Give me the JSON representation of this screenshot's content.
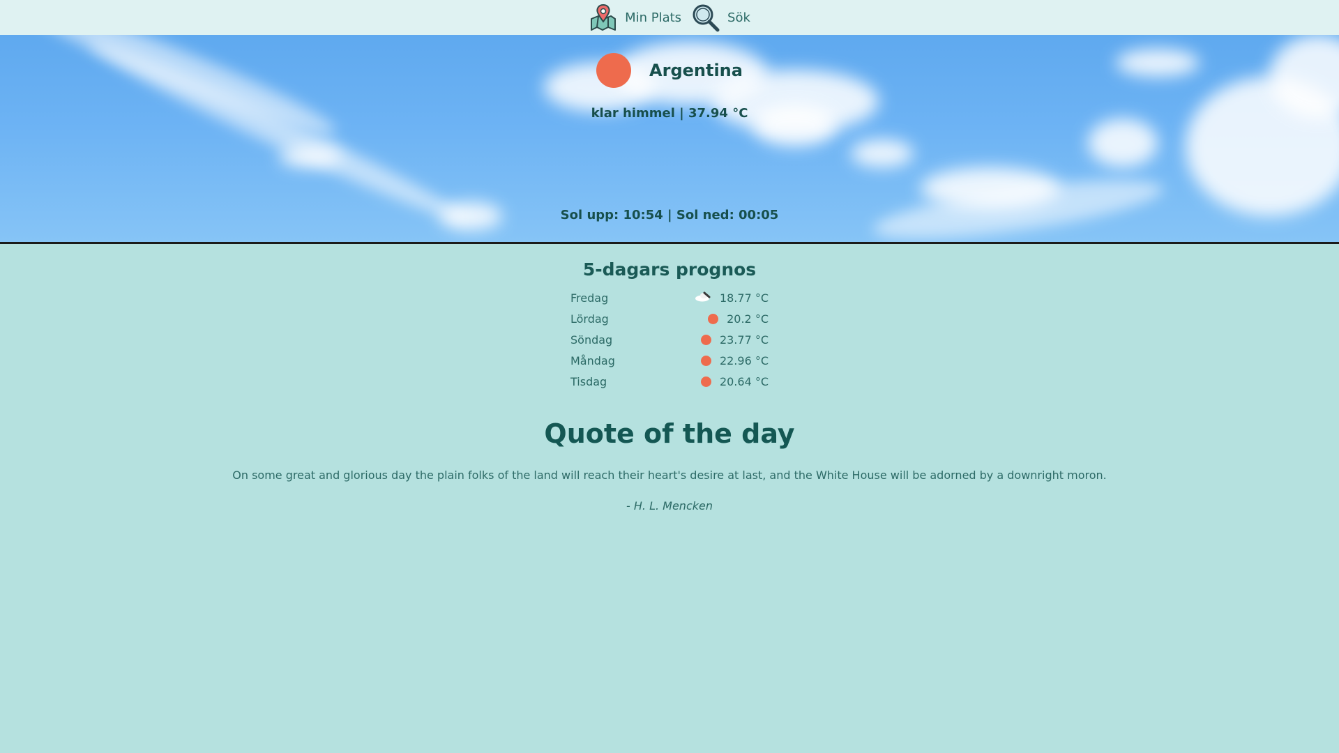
{
  "nav": {
    "my_location_label": "Min Plats",
    "my_location_icon": "map-pin-icon",
    "search_label": "Sök",
    "search_icon": "search-icon"
  },
  "current": {
    "location": "Argentina",
    "condition_temp": "klar himmel | 37.94 °C",
    "sun_times": "Sol upp: 10:54 |  Sol ned: 00:05",
    "icon": "sun-icon"
  },
  "forecast": {
    "title": "5-dagars prognos",
    "days": [
      {
        "day": "Fredag",
        "temp": "18.77 °C",
        "icon": "partly-cloudy-icon"
      },
      {
        "day": "Lördag",
        "temp": "20.2 °C",
        "icon": "sun-icon"
      },
      {
        "day": "Söndag",
        "temp": "23.77 °C",
        "icon": "sun-icon"
      },
      {
        "day": "Måndag",
        "temp": "22.96 °C",
        "icon": "sun-icon"
      },
      {
        "day": "Tisdag",
        "temp": "20.64 °C",
        "icon": "sun-icon"
      }
    ]
  },
  "quote": {
    "title": "Quote of the day",
    "text": "On some great and glorious day the plain folks of the land will reach their heart's desire at last, and the White House will be adorned by a downright moron.",
    "author": "- H. L. Mencken"
  },
  "colors": {
    "page_bg": "#b5e1df",
    "nav_bg": "#dff2f2",
    "accent_sun": "#ee6b4d",
    "text_dark": "#174f4c"
  }
}
